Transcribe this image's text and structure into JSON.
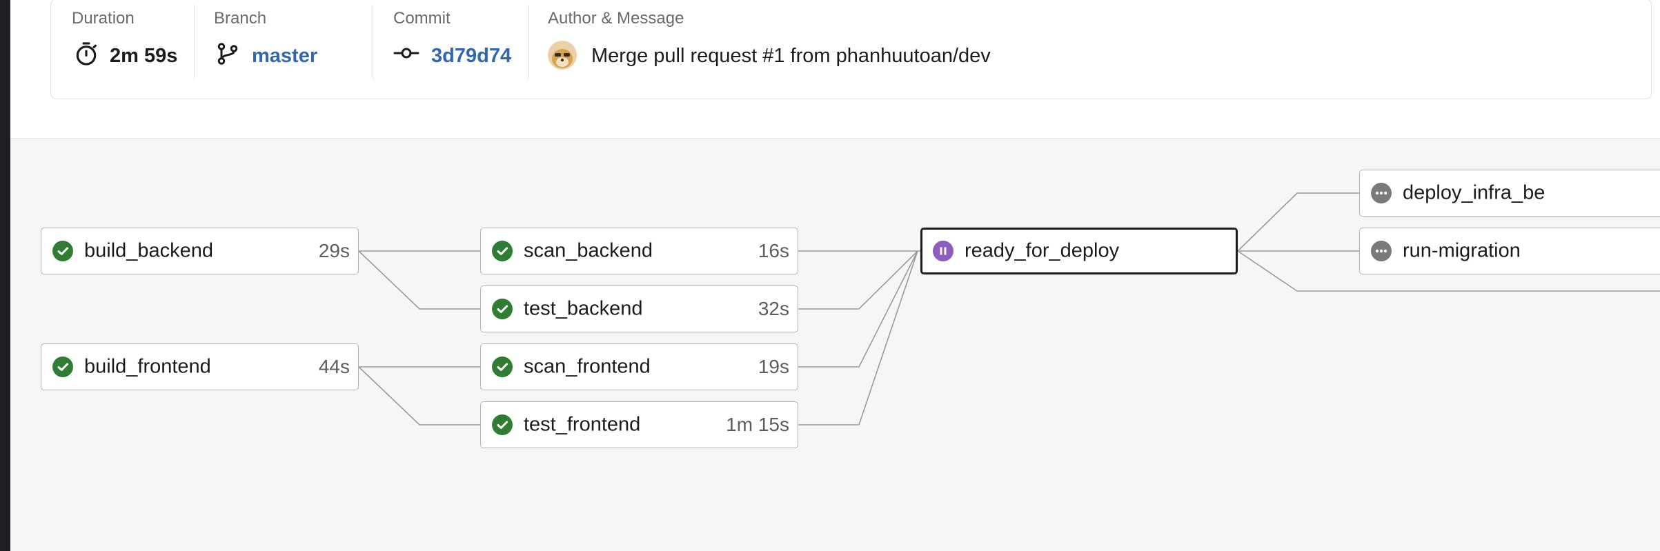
{
  "summary": {
    "duration": {
      "label": "Duration",
      "value": "2m 59s",
      "icon": "stopwatch-icon"
    },
    "branch": {
      "label": "Branch",
      "value": "master",
      "icon": "git-branch-icon"
    },
    "commit": {
      "label": "Commit",
      "value": "3d79d74",
      "icon": "git-commit-icon"
    },
    "author": {
      "label": "Author & Message",
      "message": "Merge pull request #1 from phanhuutoan/dev",
      "avatar": "author-avatar"
    }
  },
  "jobs": {
    "build_backend": {
      "name": "build_backend",
      "duration": "29s",
      "status": "success"
    },
    "build_frontend": {
      "name": "build_frontend",
      "duration": "44s",
      "status": "success"
    },
    "scan_backend": {
      "name": "scan_backend",
      "duration": "16s",
      "status": "success"
    },
    "test_backend": {
      "name": "test_backend",
      "duration": "32s",
      "status": "success"
    },
    "scan_frontend": {
      "name": "scan_frontend",
      "duration": "19s",
      "status": "success"
    },
    "test_frontend": {
      "name": "test_frontend",
      "duration": "1m 15s",
      "status": "success"
    },
    "ready_for_deploy": {
      "name": "ready_for_deploy",
      "duration": "",
      "status": "on-hold"
    },
    "deploy_infra_be": {
      "name": "deploy_infra_be",
      "duration": "",
      "status": "not-run"
    },
    "run_migration": {
      "name": "run-migration",
      "duration": "",
      "status": "not-run"
    }
  },
  "colors": {
    "success": "#2e7d32",
    "on_hold": "#8e5cc0",
    "not_run": "#7a7a7a",
    "link": "#2f68b1"
  }
}
